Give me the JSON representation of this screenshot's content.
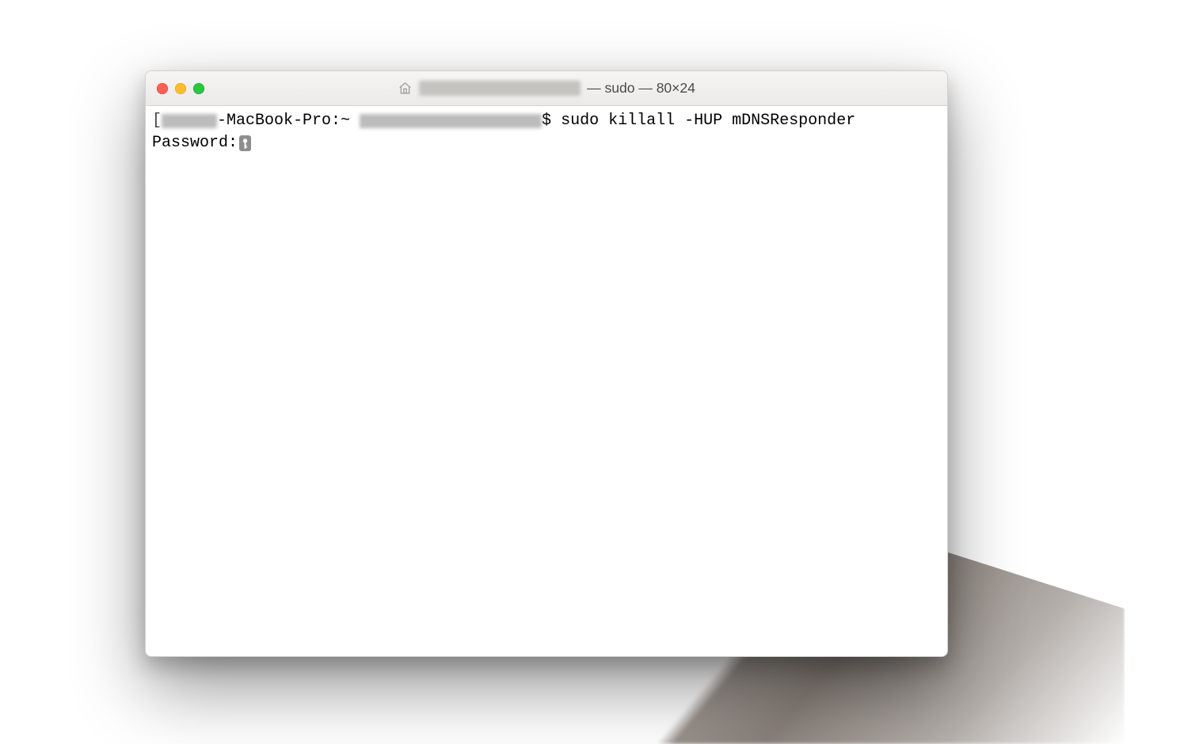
{
  "window": {
    "title_suffix": " — sudo — 80×24"
  },
  "terminal": {
    "bracket_open": "[",
    "host_suffix": "-MacBook-Pro:~ ",
    "prompt_symbol": "$ ",
    "command": "sudo killall -HUP mDNSResponder",
    "password_label": "Password:"
  }
}
